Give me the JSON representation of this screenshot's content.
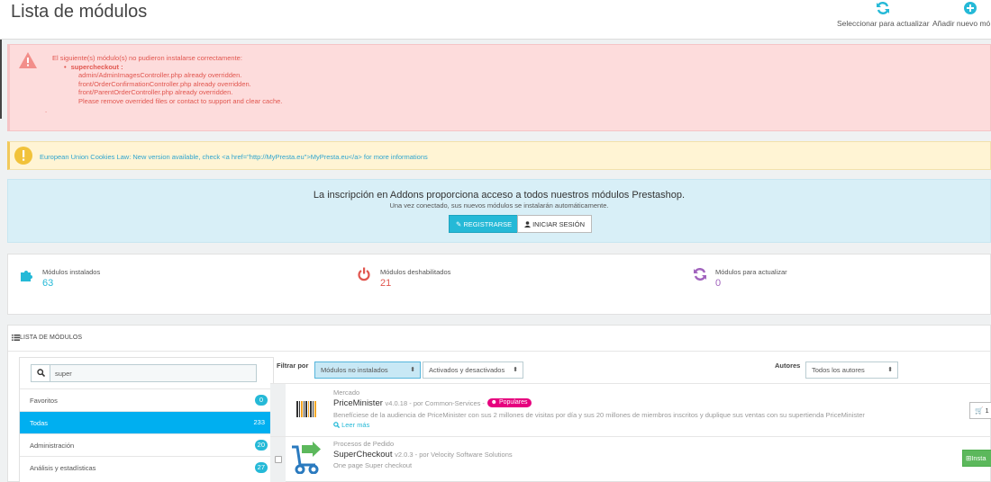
{
  "header": {
    "title": "Lista de módulos",
    "actions": [
      {
        "label": "Seleccionar para actualizar",
        "icon": "refresh-icon"
      },
      {
        "label": "Añadir nuevo mó",
        "icon": "plus-circle-icon"
      }
    ]
  },
  "alerts": {
    "danger": {
      "intro": "El siguiente(s) módulo(s) no pudieron instalarse correctamente:",
      "module": "supercheckout",
      "colon": ":",
      "lines": [
        "admin/AdminImagesController.php already overridden.",
        "front/OrderConfirmationController.php already overridden.",
        "front/ParentOrderController.php already overridden.",
        "Please remove overrided files or contact to support and clear cache."
      ],
      "dot": "."
    },
    "warning": {
      "text": "European Union Cookies Law: New version available, check <a href=\"http://MyPresta.eu\">MyPresta.eu</a> for more informations"
    },
    "info": {
      "heading": "La inscripción en Addons proporciona acceso a todos nuestros módulos Prestashop.",
      "subtext": "Una vez conectado, sus nuevos módulos se instalarán automáticamente.",
      "register_label": "REGISTRARSE",
      "login_label": "INICIAR SESIÓN"
    }
  },
  "stats": [
    {
      "label": "Módulos instalados",
      "value": "63",
      "color": "#25b9d7"
    },
    {
      "label": "Módulos deshabilitados",
      "value": "21",
      "color": "#e1564f"
    },
    {
      "label": "Módulos para actualizar",
      "value": "0",
      "color": "#a163bd"
    }
  ],
  "modules": {
    "title": "LISTA DE MÓDULOS",
    "search": {
      "value": "super"
    },
    "categories": [
      {
        "name": "Favoritos",
        "count": "0"
      },
      {
        "name": "Todas",
        "count": "233"
      },
      {
        "name": "Administración",
        "count": "20"
      },
      {
        "name": "Análisis y estadísticas",
        "count": "27"
      }
    ],
    "filter": {
      "label": "Filtrar por",
      "status_value": "Módulos no instalados",
      "active_value": "Activados y desactivados",
      "authors_label": "Autores",
      "authors_value": "Todos los autores"
    },
    "list": [
      {
        "category": "Mercado",
        "name": "PriceMinister",
        "meta": "v4.0.18 - por Common-Services -",
        "badge": "Populares",
        "description": "Benefíciese de la audiencia de PriceMinister con sus 2 millones de visitas por día y sus 20 millones de miembros inscritos y duplique sus ventas con su supertienda PriceMinister",
        "more": "Leer más",
        "action": "1"
      },
      {
        "category": "Procesos de Pedido",
        "name": "SuperCheckout",
        "meta": "v2.0.3 - por Velocity Software Solutions",
        "description": "One page Super checkout",
        "action": "Insta"
      }
    ]
  },
  "colors": {
    "accent": "#25b9d7",
    "danger": "#e1564f",
    "active_category": "#00aff0",
    "install": "#5cb85c"
  }
}
